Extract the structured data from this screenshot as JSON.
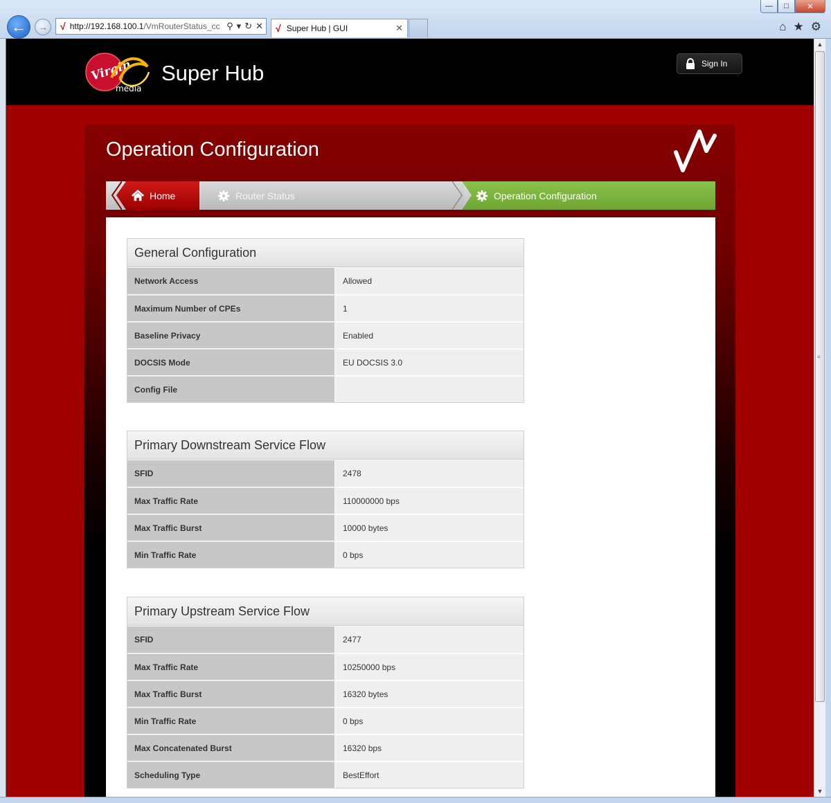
{
  "browser": {
    "address_host": "http://192.168.100.1",
    "address_rest": "/VmRouterStatus_cc",
    "tab_title": "Super Hub | GUI"
  },
  "header": {
    "brand_title": "Super Hub",
    "signin_label": "Sign In"
  },
  "page": {
    "title": "Operation Configuration"
  },
  "breadcrumb": {
    "home": "Home",
    "router_status": "Router Status",
    "current": "Operation Configuration"
  },
  "colors": {
    "brand_red": "#a00000",
    "breadcrumb_active": "#7cb342"
  },
  "sections": [
    {
      "title": "General Configuration",
      "rows": [
        {
          "label": "Network Access",
          "value": "Allowed"
        },
        {
          "label": "Maximum Number of CPEs",
          "value": "1"
        },
        {
          "label": "Baseline Privacy",
          "value": "Enabled"
        },
        {
          "label": "DOCSIS Mode",
          "value": "EU DOCSIS 3.0"
        },
        {
          "label": "Config File",
          "value": ""
        }
      ]
    },
    {
      "title": "Primary Downstream Service Flow",
      "rows": [
        {
          "label": "SFID",
          "value": "2478"
        },
        {
          "label": "Max Traffic Rate",
          "value": "110000000 bps"
        },
        {
          "label": "Max Traffic Burst",
          "value": "10000 bytes"
        },
        {
          "label": "Min Traffic Rate",
          "value": "0 bps"
        }
      ]
    },
    {
      "title": "Primary Upstream Service Flow",
      "rows": [
        {
          "label": "SFID",
          "value": "2477"
        },
        {
          "label": "Max Traffic Rate",
          "value": "10250000 bps"
        },
        {
          "label": "Max Traffic Burst",
          "value": "16320 bytes"
        },
        {
          "label": "Min Traffic Rate",
          "value": "0 bps"
        },
        {
          "label": "Max Concatenated Burst",
          "value": "16320 bps"
        },
        {
          "label": "Scheduling Type",
          "value": "BestEffort"
        }
      ]
    }
  ]
}
